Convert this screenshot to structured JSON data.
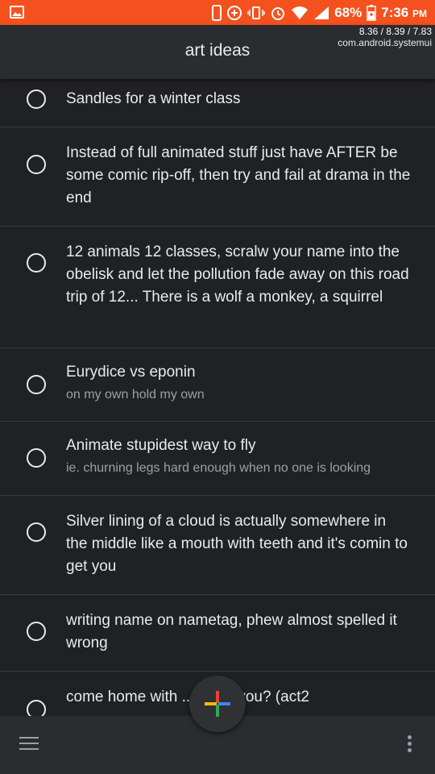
{
  "status_bar": {
    "battery": "68%",
    "time": "7:36",
    "ampm": "PM",
    "background": "#f4511e",
    "icons": [
      "image-icon",
      "phone-icon",
      "data-saver-icon",
      "vibrate-icon",
      "alarm-icon",
      "wifi-icon",
      "signal-icon",
      "battery-icon"
    ]
  },
  "overlay": {
    "load": "8.36 / 8.39 / 7.83",
    "process": "com.android.systemui"
  },
  "header": {
    "title": "art ideas"
  },
  "items": [
    {
      "title": "Sandles for a winter class",
      "subtitle": ""
    },
    {
      "title": "Instead of full animated stuff just have AFTER be some comic rip-off, then try and fail at drama in the end",
      "subtitle": ""
    },
    {
      "title": "12 animals 12 classes, scralw your name into the obelisk and let the pollution fade away on this road trip of 12... There is a wolf a monkey, a squirrel",
      "subtitle": ""
    },
    {
      "title": "Eurydice vs eponin",
      "subtitle": "on my own hold my own"
    },
    {
      "title": "Animate stupidest way to fly",
      "subtitle": "ie. churning legs hard enough when no one is looking"
    },
    {
      "title": "Silver lining of a cloud is actually somewhere in the middle like a mouth with teeth and it's comin to get you",
      "subtitle": ""
    },
    {
      "title": "writing name on nametag, phew almost spelled it wrong",
      "subtitle": ""
    },
    {
      "title": "come home with ... o are you? (act2",
      "subtitle": ""
    }
  ],
  "bottom_bar": {
    "menu_icon": "hamburger-menu-icon",
    "more_icon": "more-vertical-icon"
  },
  "fab": {
    "icon": "google-plus-icon",
    "colors": [
      "#ea4335",
      "#fbbc05",
      "#34a853",
      "#4285f4"
    ]
  }
}
